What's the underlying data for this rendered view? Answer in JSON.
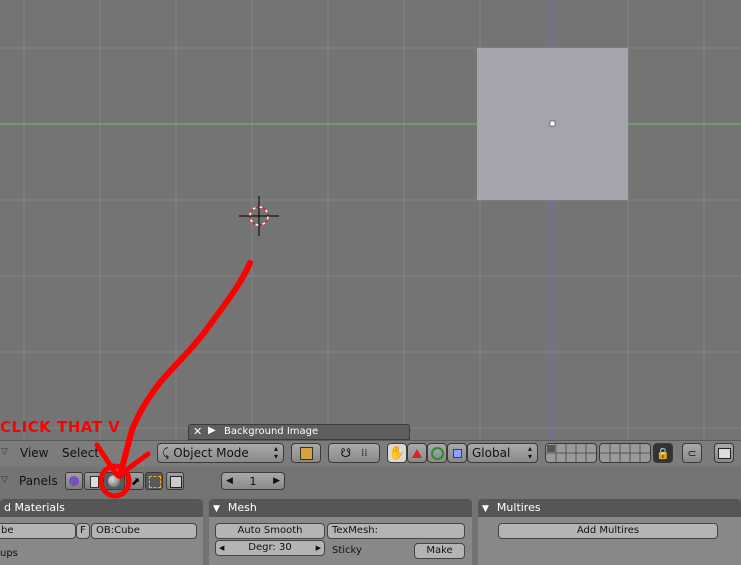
{
  "viewport": {
    "annotation": "CLICK THAT V"
  },
  "bg_image_strip": {
    "label": "Background Image"
  },
  "header": {
    "menus": [
      {
        "label": "View"
      },
      {
        "label": "Select"
      }
    ],
    "mode": "Object Mode",
    "orientation": "Global"
  },
  "panels_bar": {
    "label": "Panels",
    "frame": "1"
  },
  "panels": {
    "materials": {
      "title": "d Materials",
      "mesh_field": "be",
      "f_label": "F",
      "ob_field": "OB:Cube",
      "groups": "ups"
    },
    "mesh": {
      "title": "Mesh",
      "auto_smooth": "Auto Smooth",
      "degr": "Degr: 30",
      "texmesh": "TexMesh:",
      "sticky": "Sticky",
      "make": "Make"
    },
    "multires": {
      "title": "Multires",
      "add": "Add Multires"
    }
  },
  "colors": {
    "annotation": "#ff0000",
    "grid_bg": "#747474",
    "cube_face": "#a5a3ab"
  }
}
